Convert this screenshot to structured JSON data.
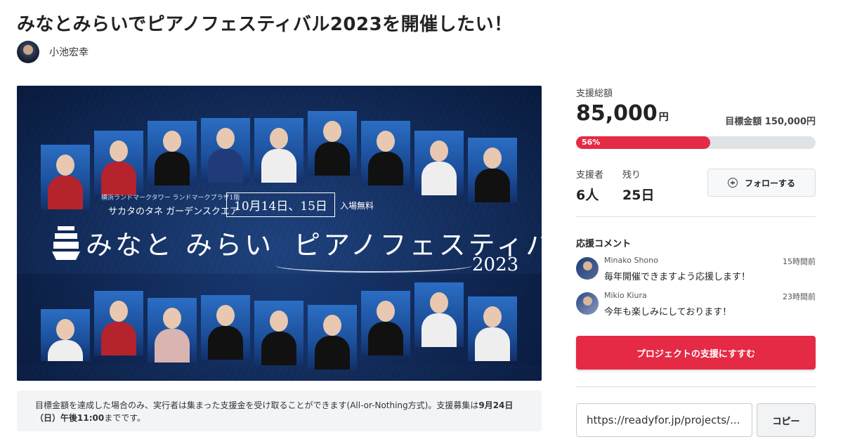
{
  "project": {
    "title": "みなとみらいでピアノフェスティバル2023を開催したい！",
    "owner_name": "小池宏幸"
  },
  "hero": {
    "venue_small": "横浜ランドマークタワー ランドマークプラザ1階",
    "venue_large": "サカタのタネ ガーデンスクエア",
    "dates": "10月14日、15日",
    "admission": "入場無料",
    "logo_part1": "みなと みらい",
    "logo_part2": "ピアノフェスティバル",
    "year": "2023"
  },
  "notice": {
    "text_before": "目標金額を達成した場合のみ、実行者は集まった支援金を受け取ることができます(All-or-Nothing方式)。支援募集は",
    "deadline": "9月24日（日）午後11:00",
    "text_after": "までです。"
  },
  "funding": {
    "total_label": "支援総額",
    "total_amount": "85,000",
    "currency": "円",
    "goal_label": "目標金額 150,000円",
    "progress_percent": 56,
    "progress_label": "56%",
    "supporters_label": "支援者",
    "supporters_value": "6人",
    "remaining_label": "残り",
    "remaining_value": "25日",
    "follow_label": "フォローする"
  },
  "comments": {
    "title": "応援コメント",
    "items": [
      {
        "name": "Minako Shono",
        "time": "15時間前",
        "text": "毎年開催できますよう応援します！"
      },
      {
        "name": "Mikio Kiura",
        "time": "23時間前",
        "text": "今年も楽しみにしております！"
      }
    ]
  },
  "actions": {
    "support_label": "プロジェクトの支援にすすむ",
    "share_url": "https://readyfor.jp/projects/...",
    "copy_label": "コピー"
  },
  "colors": {
    "accent": "#e52a46",
    "hero_bg": "#0f2753"
  }
}
